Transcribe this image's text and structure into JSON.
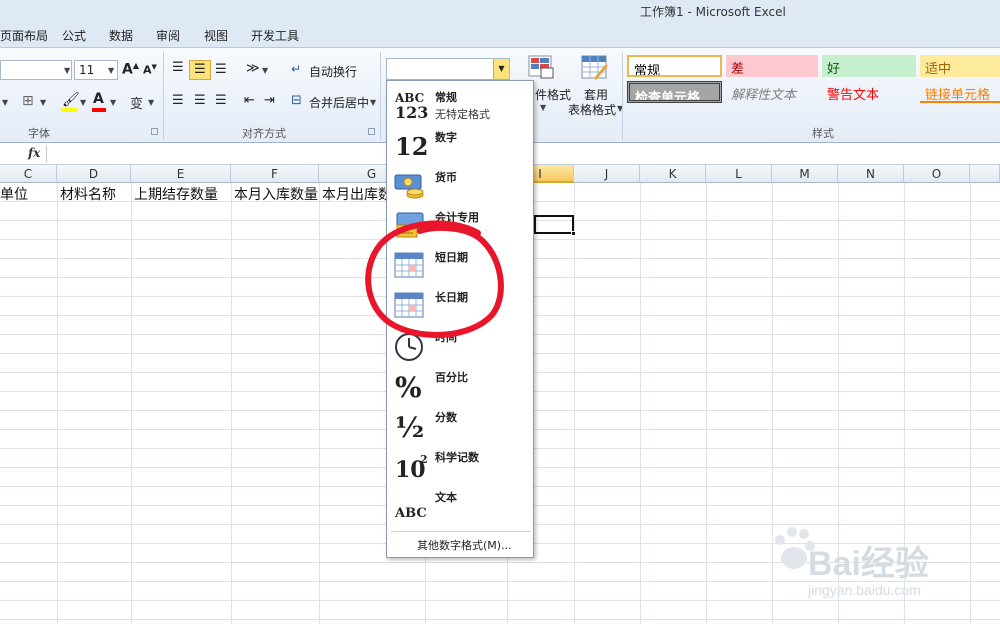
{
  "window": {
    "title": "工作簿1 - Microsoft Excel"
  },
  "tabs": [
    "页面布局",
    "公式",
    "数据",
    "审阅",
    "视图",
    "开发工具"
  ],
  "ribbon": {
    "font": {
      "size": "11",
      "group_label": "字体"
    },
    "alignment": {
      "wrap_text": "自动换行",
      "merge_center": "合并后居中",
      "group_label": "对齐方式"
    },
    "cond_format_label": "件格式",
    "table_format_label_1": "套用",
    "table_format_label_2": "表格格式",
    "styles": {
      "group_label": "样式",
      "cells": [
        {
          "label": "常规",
          "bg": "#ffffff",
          "color": "#000000"
        },
        {
          "label": "差",
          "bg": "#ffc7ce",
          "color": "#9c0006"
        },
        {
          "label": "好",
          "bg": "#c6efce",
          "color": "#006100"
        },
        {
          "label": "适中",
          "bg": "#ffeb9c",
          "color": "#9c6500"
        },
        {
          "label": "检查单元格",
          "bg": "#a5a5a5",
          "color": "#ffffff"
        },
        {
          "label": "解释性文本",
          "bg": "#ffffff",
          "color": "#7f7f7f"
        },
        {
          "label": "警告文本",
          "bg": "#ffffff",
          "color": "#ff0000"
        },
        {
          "label": "链接单元格",
          "bg": "#ffffff",
          "color": "#fa7d00"
        }
      ]
    }
  },
  "formula_bar": {
    "fx": "fx"
  },
  "grid": {
    "columns": [
      "C",
      "D",
      "E",
      "F",
      "G",
      "I",
      "J",
      "K",
      "L",
      "M",
      "N",
      "O"
    ],
    "row1": [
      "单位",
      "材料名称",
      "上期结存数量",
      "本月入库数量",
      "本月出库数"
    ]
  },
  "number_format_menu": {
    "items": [
      {
        "label": "常规",
        "sub": "无特定格式",
        "icon": "general-abc123-icon"
      },
      {
        "label": "数字",
        "icon": "number-12-icon"
      },
      {
        "label": "货币",
        "icon": "currency-icon"
      },
      {
        "label": "会计专用",
        "icon": "accounting-icon"
      },
      {
        "label": "短日期",
        "icon": "short-date-calendar-icon"
      },
      {
        "label": "长日期",
        "icon": "long-date-calendar-icon"
      },
      {
        "label": "时间",
        "icon": "clock-icon"
      },
      {
        "label": "百分比",
        "icon": "percent-icon"
      },
      {
        "label": "分数",
        "icon": "fraction-icon"
      },
      {
        "label": "科学记数",
        "icon": "scientific-icon"
      },
      {
        "label": "文本",
        "icon": "text-abc-icon"
      }
    ],
    "footer": "其他数字格式(M)..."
  },
  "annotation": {
    "shape": "red-freehand-circle",
    "color": "#e8152b"
  },
  "watermark": {
    "text": "Bai经验",
    "sub": "jingyan.baidu.com"
  },
  "glyphs": {
    "abc": "ABC",
    "n123": "123",
    "n12": "12",
    "pct": "%",
    "half": "½",
    "ten": "10",
    "exp": "2",
    "grow": "A",
    "shrink": "A",
    "fill": "A"
  }
}
